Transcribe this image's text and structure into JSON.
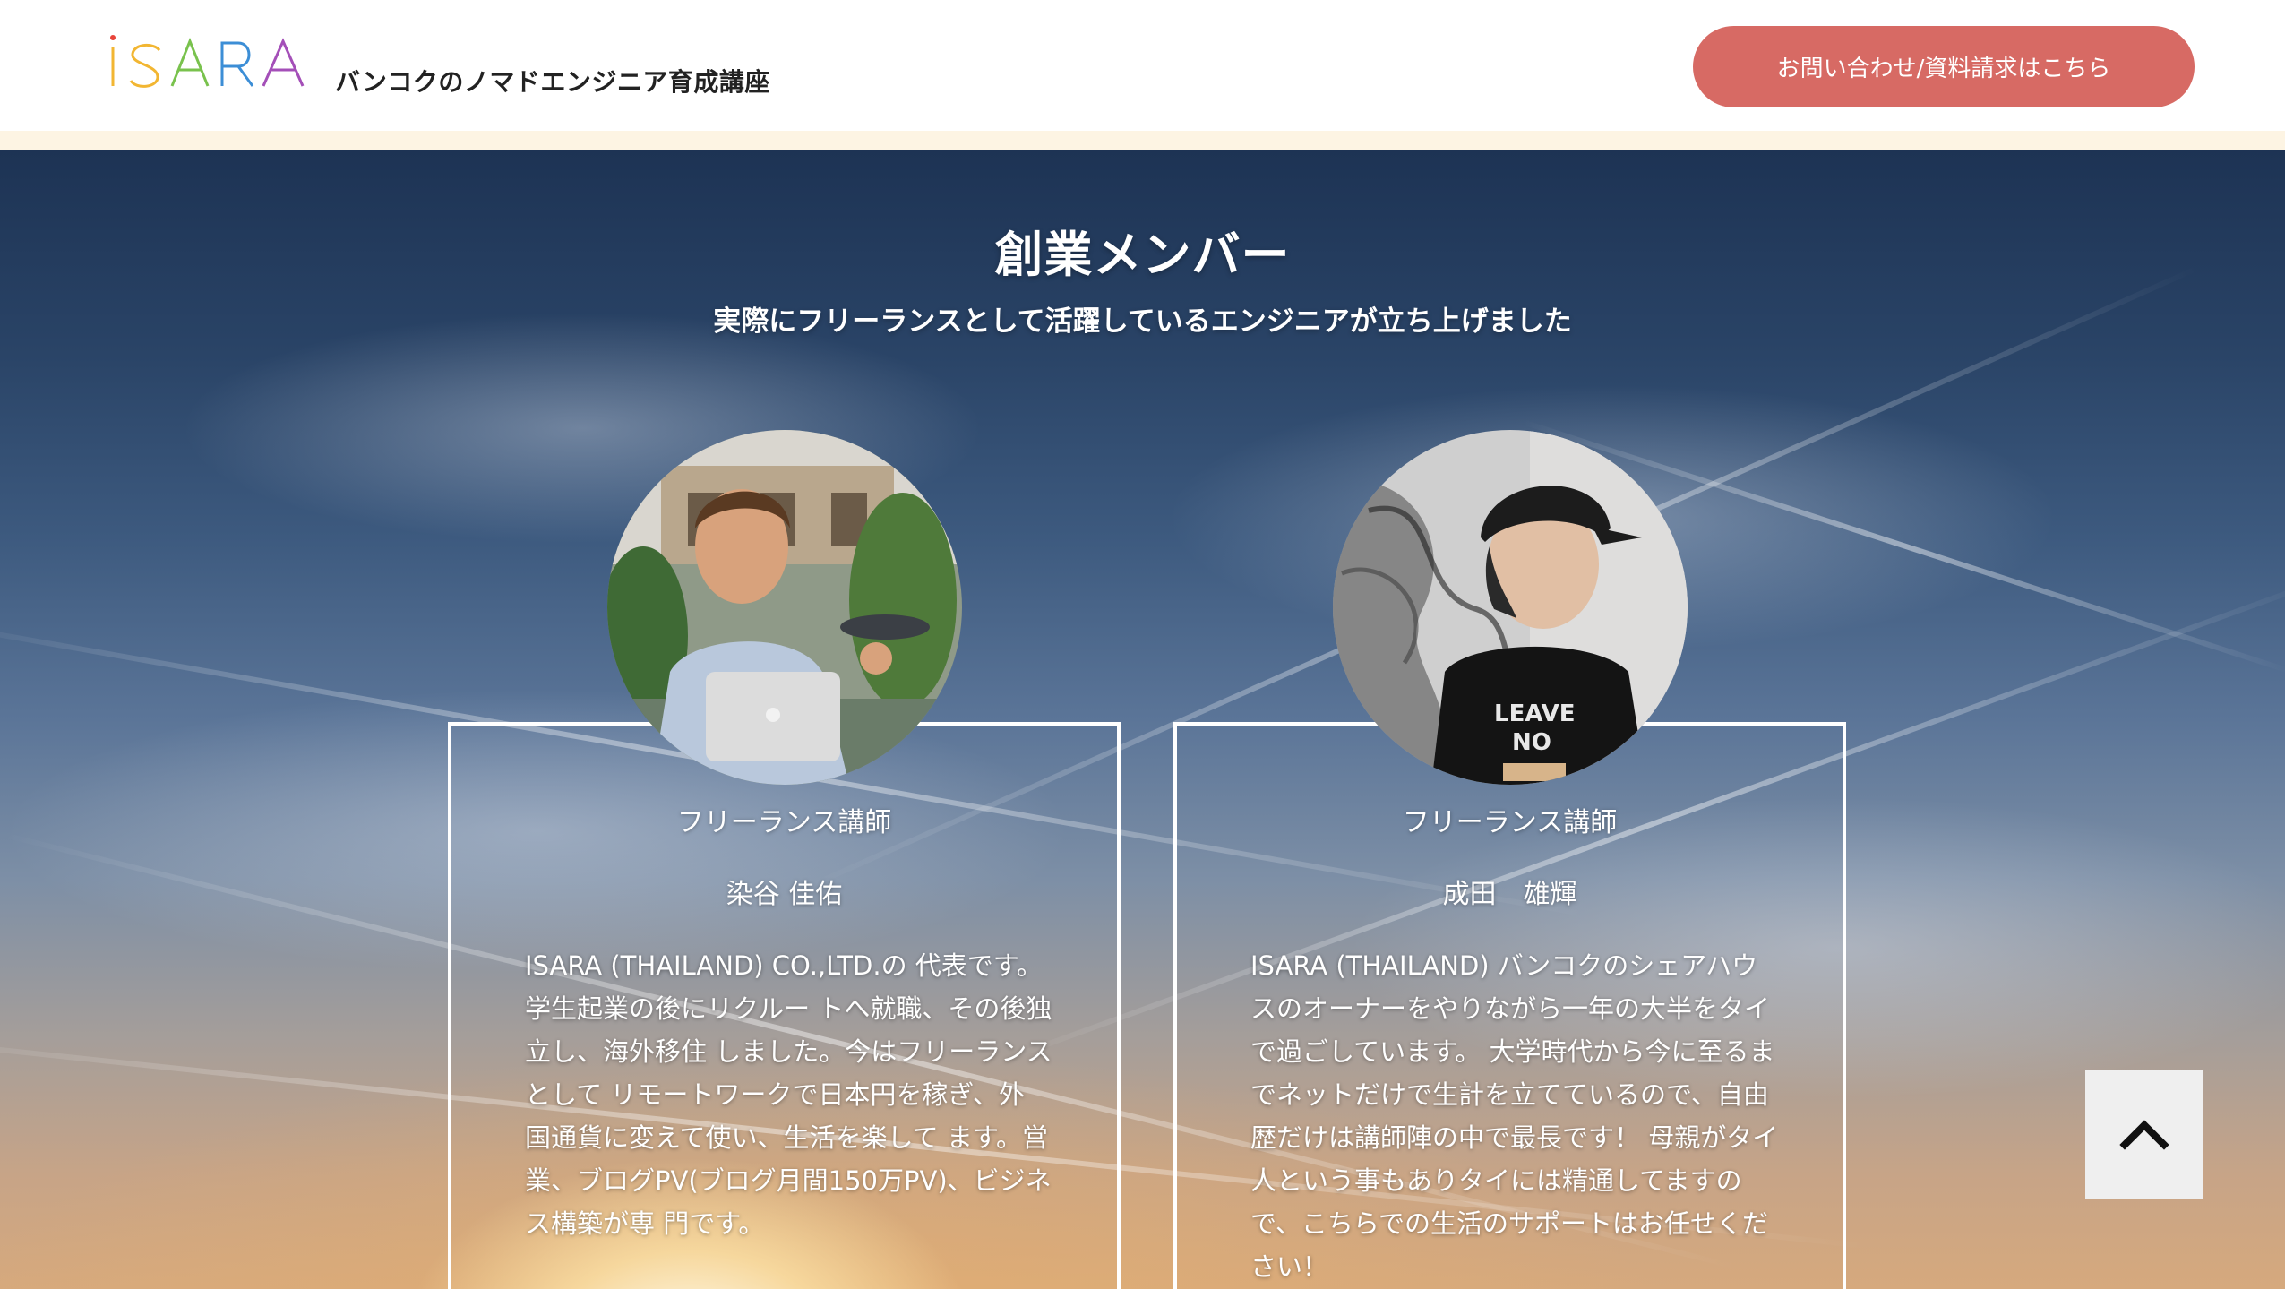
{
  "header": {
    "logo_text": "ISARA",
    "tagline": "バンコクのノマドエンジニア育成講座",
    "contact_button": "お問い合わせ/資料請求はこちら"
  },
  "section": {
    "title": "創業メンバー",
    "subtitle": "実際にフリーランスとして活躍しているエンジニアが立ち上げました"
  },
  "members": [
    {
      "role": "フリーランス講師",
      "name": "染谷 佳佑",
      "bio": "ISARA (THAILAND) CO.,LTD.の 代表です。学生起業の後にリクルー トへ就職、その後独立し、海外移住 しました。今はフリーランスとして リモートワークで日本円を稼ぎ、外 国通貨に変えて使い、生活を楽して ます。営業、ブログPV(ブログ月間150万PV)、ビジネス構築が専 門です。"
    },
    {
      "role": "フリーランス講師",
      "name": "成田　雄輝",
      "bio": "ISARA (THAILAND) バンコクのシェアハウスのオーナーをやりながら一年の大半をタイで過ごしています。 大学時代から今に至るまでネットだけで生計を立てているので、自由歴だけは講師陣の中で最長です！ 母親がタイ人という事もありタイには精通してますので、こちらでの生活のサポートはお任せください！"
    }
  ],
  "colors": {
    "accent": "#d76a64",
    "header_strip": "#fdf4e3"
  },
  "icons": {
    "scroll_top": "chevron-up-icon"
  }
}
